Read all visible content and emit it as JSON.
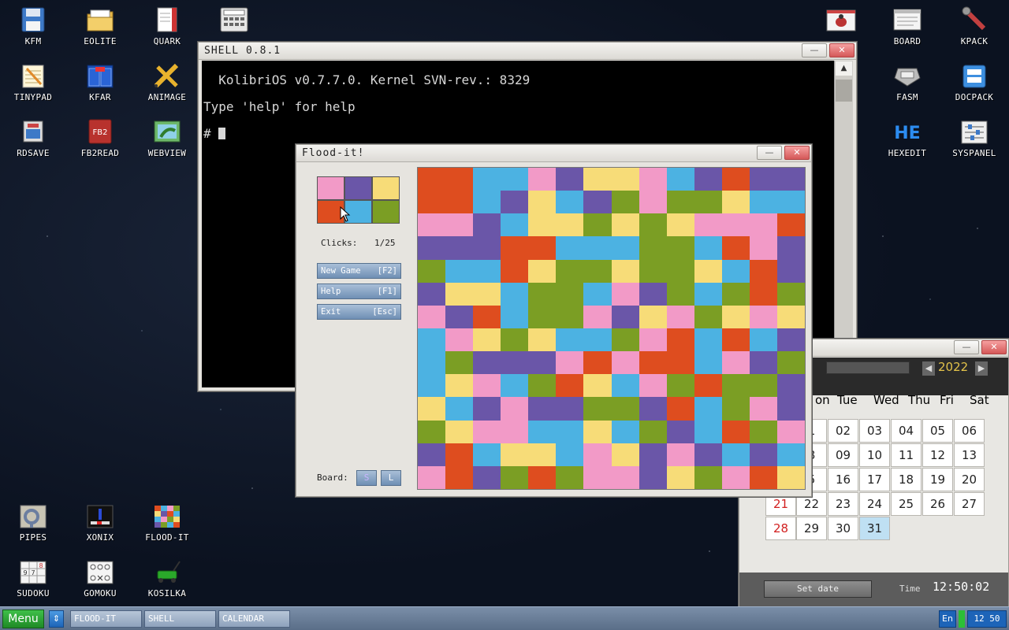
{
  "desktop": {
    "icons_left": [
      {
        "label": "KFM",
        "icon": "floppy-icon"
      },
      {
        "label": "EOLITE",
        "icon": "folder-icon"
      },
      {
        "label": "QUARK",
        "icon": "notebook-icon"
      },
      {
        "label": "TINYPAD",
        "icon": "notepad-icon"
      },
      {
        "label": "KFAR",
        "icon": "grid-manager-icon"
      },
      {
        "label": "ANIMAGE",
        "icon": "pencil-brush-icon"
      },
      {
        "label": "RDSAVE",
        "icon": "ramdisk-save-icon"
      },
      {
        "label": "FB2READ",
        "icon": "book-icon"
      },
      {
        "label": "WEBVIEW",
        "icon": "browser-icon"
      }
    ],
    "icons_right": [
      {
        "label": "BOARD",
        "icon": "board-window-icon"
      },
      {
        "label": "KPACK",
        "icon": "wrench-icon"
      },
      {
        "label": "FASM",
        "icon": "assembler-icon"
      },
      {
        "label": "DOCPACK",
        "icon": "docpack-icon"
      },
      {
        "label": "HEXEDIT",
        "icon": "hex-editor-icon"
      },
      {
        "label": "SYSPANEL",
        "icon": "sliders-icon"
      }
    ],
    "icons_bottom": [
      {
        "label": "PIPES",
        "icon": "pipes-icon"
      },
      {
        "label": "XONIX",
        "icon": "xonix-icon"
      },
      {
        "label": "FLOOD-IT",
        "icon": "flood-it-icon"
      },
      {
        "label": "SUDOKU",
        "icon": "sudoku-icon"
      },
      {
        "label": "GOMOKU",
        "icon": "gomoku-icon"
      },
      {
        "label": "KOSILKA",
        "icon": "lawnmower-icon"
      }
    ],
    "top_extra_icons": [
      "calculator-icon",
      "bug-icon"
    ]
  },
  "shell": {
    "title": "SHELL 0.8.1",
    "lines": [
      "  KolibriOS v0.7.7.0. Kernel SVN-rev.: 8329",
      "Type 'help' for help",
      "# "
    ]
  },
  "flood": {
    "title": "Flood-it!",
    "palette": [
      "#f29ac7",
      "#6a56a8",
      "#f7dc78",
      "#de4d1f",
      "#4cb2e2",
      "#7b9e24"
    ],
    "clicks_label": "Clicks:",
    "clicks_value": "1/25",
    "buttons": [
      {
        "label": "New Game",
        "key": "[F2]"
      },
      {
        "label": "Help",
        "key": "[F1]"
      },
      {
        "label": "Exit",
        "key": "[Esc]"
      }
    ],
    "board_label": "Board:",
    "size_buttons": [
      "S",
      "L"
    ],
    "grid": [
      "OOBBPVYYPBVOVV",
      "OOBVYBVGPGGYBB",
      "PPVBYYGYGYPPPO",
      "VVVOOBBBGGBOPV",
      "GBBOYGGYGGYBOV",
      "VYYBGGBPVGBGOG",
      "PVOBGGPVYPGYPY",
      "BPYGYBBGPOBOBV",
      "BGVVVPOPOOBPVG",
      "BYPBGOYBPGOGGV",
      "YBVPVVGGVOBGPV",
      "GYPPBBYBGVBOGP",
      "VOBYYBPYVPVBVB",
      "POVGOGPPVYGPOY"
    ]
  },
  "calendar": {
    "year": "2022",
    "weekdays": [
      "on",
      "Tue",
      "Wed",
      "Thu",
      "Fri",
      "Sat"
    ],
    "rows": [
      [
        "1",
        "02",
        "03",
        "04",
        "05",
        "06"
      ],
      [
        "8",
        "09",
        "10",
        "11",
        "12",
        "13"
      ],
      [
        "5",
        "16",
        "17",
        "18",
        "19",
        "20"
      ],
      [
        "21",
        "22",
        "23",
        "24",
        "25",
        "26",
        "27"
      ],
      [
        "28",
        "29",
        "30",
        "31"
      ]
    ],
    "today": "31",
    "set_date_label": "Set date",
    "time_label": "Time",
    "time_value": "12:50:02"
  },
  "taskbar": {
    "menu_label": "Menu",
    "tasks": [
      "FLOOD-IT",
      "SHELL",
      "CALENDAR"
    ],
    "lang": "En",
    "clock": "12 50"
  }
}
